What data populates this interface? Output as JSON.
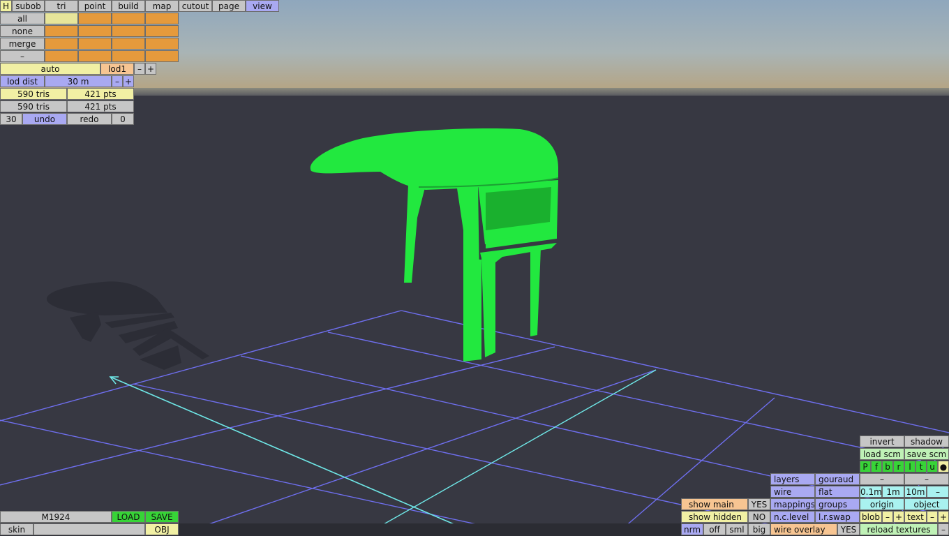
{
  "menu": {
    "h": "H",
    "tabs": [
      "subob",
      "tri",
      "point",
      "build",
      "map",
      "cutout",
      "page",
      "view"
    ]
  },
  "left": {
    "rows": [
      "all",
      "none",
      "merge",
      "–"
    ],
    "auto": "auto",
    "lod": "lod1",
    "lod_minus": "–",
    "lod_plus": "+",
    "lod_dist_label": "lod dist",
    "lod_dist_value": "30 m",
    "dist_minus": "–",
    "dist_plus": "+",
    "tris1": "590 tris",
    "pts1": "421 pts",
    "tris2": "590 tris",
    "pts2": "421 pts",
    "undo_count": "30",
    "undo": "undo",
    "redo": "redo",
    "redo_count": "0"
  },
  "bottom_left": {
    "model": "M1924",
    "load": "LOAD",
    "save": "SAVE",
    "skin": "skin",
    "skin_value": "",
    "obj": "OBJ"
  },
  "bottom_right": {
    "show_main": "show main",
    "show_main_val": "YES",
    "show_hidden": "show hidden",
    "show_hidden_val": "NO",
    "nrm": "nrm",
    "off": "off",
    "sml": "sml",
    "big": "big",
    "layers": "layers",
    "gouraud": "gouraud",
    "wire": "wire",
    "flat": "flat",
    "mappings": "mappings",
    "groups": "groups",
    "nc_level": "n.c.level",
    "lr_swap": "l.r.swap",
    "wire_overlay": "wire overlay",
    "wire_overlay_val": "YES",
    "invert": "invert",
    "shadow": "shadow",
    "load_scm": "load scm",
    "save_scm": "save scm",
    "views": [
      "P",
      "f",
      "b",
      "r",
      "l",
      "t",
      "u"
    ],
    "dot": "●",
    "minus_a": "–",
    "minus_b": "–",
    "step_01": "0.1m",
    "step_1": "1m",
    "step_10": "10m",
    "step_minus": "–",
    "origin": "origin",
    "object": "object",
    "blob": "blob",
    "blob_minus": "–",
    "blob_plus": "+",
    "text": "text",
    "text_minus": "–",
    "text_plus": "+",
    "reload": "reload textures",
    "reload_minus": "–"
  },
  "colors": {
    "model": "#22e83f",
    "grid": "#6f6ff0",
    "axis": "#6fe8e8",
    "shadow": "#2c2d36"
  }
}
